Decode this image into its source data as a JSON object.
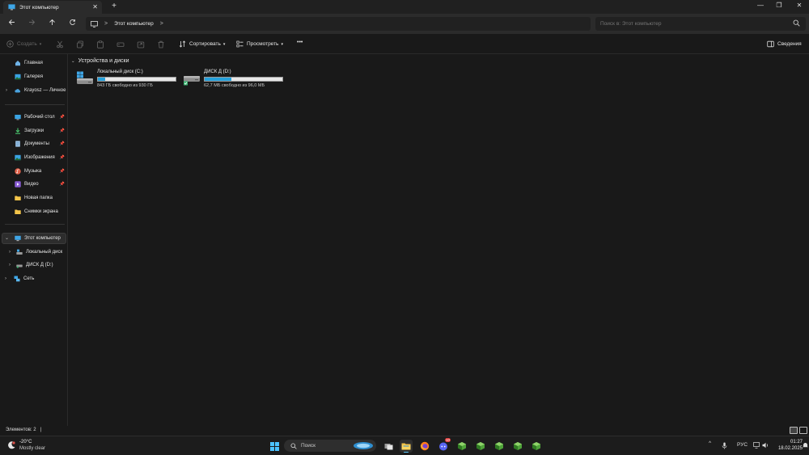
{
  "window": {
    "tab_title": "Этот компьютер",
    "new_tab": "+",
    "minimize": "—",
    "maximize": "❐",
    "close": "✕"
  },
  "address": {
    "crumb": "Этот компьютер",
    "search_placeholder": "Поиск в: Этот компьютер"
  },
  "commands": {
    "create": "Создать",
    "sort": "Сортировать",
    "view": "Просмотреть",
    "more": "•••",
    "details": "Сведения"
  },
  "sidebar": {
    "top": [
      {
        "label": "Главная"
      },
      {
        "label": "Галерея"
      },
      {
        "label": "Krayosz — Личное"
      }
    ],
    "pinned": [
      {
        "label": "Рабочий стол",
        "pin": "📌"
      },
      {
        "label": "Загрузки",
        "pin": "📌"
      },
      {
        "label": "Документы",
        "pin": "📌"
      },
      {
        "label": "Изображения",
        "pin": "📌"
      },
      {
        "label": "Музыка",
        "pin": "📌"
      },
      {
        "label": "Видео",
        "pin": "📌"
      },
      {
        "label": "Новая папка"
      },
      {
        "label": "Снимки экрана"
      }
    ],
    "tree": [
      {
        "label": "Этот компьютер"
      },
      {
        "label": "Локальный диск"
      },
      {
        "label": "ДИСК Д (D:)"
      },
      {
        "label": "Сеть"
      }
    ]
  },
  "main": {
    "group_title": "Устройства и диски",
    "drives": [
      {
        "name": "Локальный диск (C:)",
        "free_text": "843 ГБ свободно из 930 ГБ",
        "used_fraction": 0.094
      },
      {
        "name": "ДИСК Д (D:)",
        "free_text": "62,7 МБ свободно из 96,0 МБ",
        "used_fraction": 0.347
      }
    ]
  },
  "status": {
    "count": "Элементов: 2",
    "cursor": "|"
  },
  "taskbar": {
    "temp": "-20°C",
    "condition": "Mostly clear",
    "search_label": "Поиск",
    "badge": "10",
    "language": "РУС",
    "time": "01:27",
    "date": "18.02.2025"
  },
  "colors": {
    "accent": "#26a0da",
    "folder": "#f4c54a",
    "background": "#191919"
  }
}
